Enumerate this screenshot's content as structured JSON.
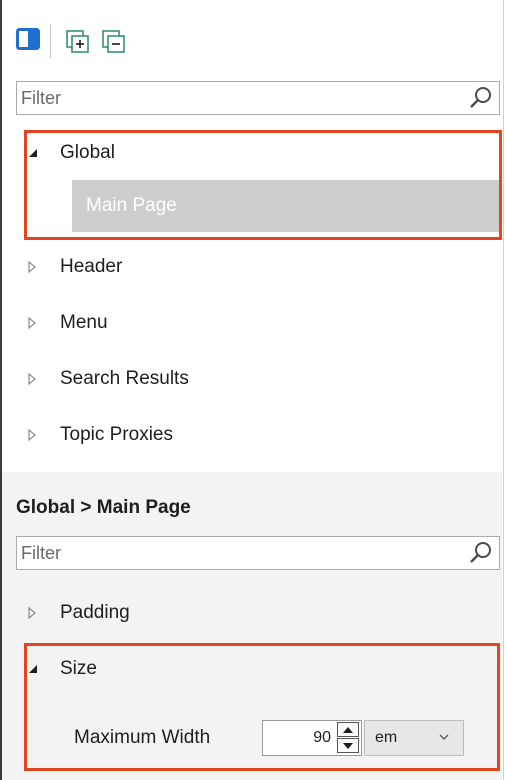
{
  "toolbar": {
    "buttons": [
      {
        "icon": "panel-toggle-icon"
      },
      {
        "icon": "expand-all-icon"
      },
      {
        "icon": "collapse-all-icon"
      }
    ]
  },
  "top_filter": {
    "placeholder": "Filter",
    "icon": "search-icon"
  },
  "tree": {
    "items": [
      {
        "label": "Global",
        "expanded": true,
        "children": [
          "Main Page"
        ]
      },
      {
        "label": "Header",
        "expanded": false
      },
      {
        "label": "Menu",
        "expanded": false
      },
      {
        "label": "Search Results",
        "expanded": false
      },
      {
        "label": "Topic Proxies",
        "expanded": false
      }
    ],
    "selected": "Main Page"
  },
  "properties": {
    "title": "Global > Main Page",
    "filter_placeholder": "Filter",
    "groups": [
      {
        "label": "Padding",
        "expanded": false
      },
      {
        "label": "Size",
        "expanded": true
      }
    ],
    "max_width": {
      "label": "Maximum Width",
      "value": "90",
      "unit": "em"
    }
  },
  "colors": {
    "accent_icon": "#1e6fd0",
    "highlight_border": "#e0461f",
    "selection_bg": "#cdcdcd"
  }
}
